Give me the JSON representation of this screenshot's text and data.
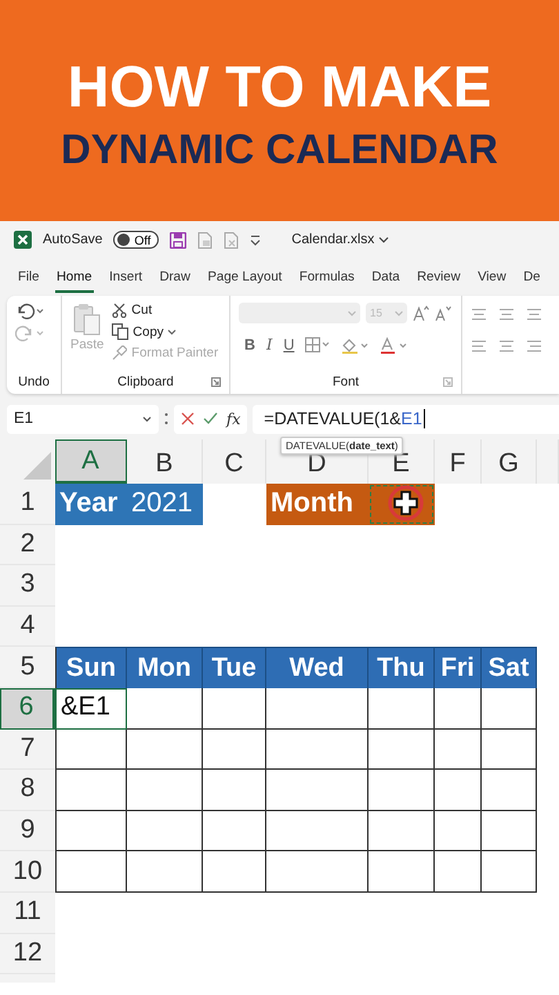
{
  "banner": {
    "line_1": "HOW TO MAKE",
    "line_2": "DYNAMIC CALENDAR"
  },
  "title_bar": {
    "autosave_label": "AutoSave",
    "autosave_toggle": {
      "text": "Off",
      "on": false
    },
    "file_name": "Calendar.xlsx"
  },
  "tabs": [
    {
      "label": "File",
      "selected": false
    },
    {
      "label": "Home",
      "selected": true
    },
    {
      "label": "Insert",
      "selected": false
    },
    {
      "label": "Draw",
      "selected": false
    },
    {
      "label": "Page Layout",
      "selected": false
    },
    {
      "label": "Formulas",
      "selected": false
    },
    {
      "label": "Data",
      "selected": false
    },
    {
      "label": "Review",
      "selected": false
    },
    {
      "label": "View",
      "selected": false
    },
    {
      "label": "De",
      "selected": false
    }
  ],
  "ribbon": {
    "undo": {
      "label": "Undo"
    },
    "clipboard": {
      "label": "Clipboard",
      "paste": "Paste",
      "cut": "Cut",
      "copy": "Copy",
      "format_painter": "Format Painter",
      "paste_disabled": true,
      "format_painter_disabled": true
    },
    "font": {
      "label": "Font",
      "size": "15",
      "bold": "B",
      "italic": "I",
      "underline": "U",
      "disabled": true
    }
  },
  "formula_bar": {
    "name_box": "E1",
    "function_label": "fx",
    "formula": "=DATEVALUE(1&",
    "formula_reference": "E1",
    "tooltip": "DATEVALUE(**date_text**)"
  },
  "sheet": {
    "columns": [
      "A",
      "B",
      "C",
      "D",
      "E",
      "F",
      "G"
    ],
    "rows": [
      {
        "number": "1",
        "kind": "plain",
        "cells": [
          {
            "text": "Year",
            "kind": "label",
            "color": "#2e75b6",
            "selected": false
          },
          {
            "text": "2021",
            "kind": "value",
            "color": "#2e75b6",
            "selected": false
          },
          {
            "kind": "blank",
            "selected": false
          },
          {
            "text": "Month",
            "kind": "label",
            "color": "#c55a11",
            "selected": false
          },
          {
            "kind": "referenced",
            "color": "#c55a11",
            "selected": false
          }
        ]
      },
      {
        "number": "2",
        "kind": "plain"
      },
      {
        "number": "3",
        "kind": "plain"
      },
      {
        "number": "4",
        "kind": "plain"
      },
      {
        "number": "5",
        "kind": "table-header",
        "cells": [
          {
            "text": "Sun",
            "selected": false
          },
          {
            "text": "Mon",
            "selected": false
          },
          {
            "text": "Tue",
            "selected": false
          },
          {
            "text": "Wed",
            "selected": false
          },
          {
            "text": "Thu",
            "selected": false
          },
          {
            "text": "Fri",
            "selected": false
          },
          {
            "text": "Sat",
            "selected": false
          }
        ]
      },
      {
        "number": "6",
        "kind": "table",
        "cells": [
          {
            "text": "&E1",
            "selected": true
          }
        ]
      },
      {
        "number": "7",
        "kind": "table"
      },
      {
        "number": "8",
        "kind": "table"
      },
      {
        "number": "9",
        "kind": "table"
      },
      {
        "number": "10",
        "kind": "table"
      },
      {
        "number": "11",
        "kind": "plain"
      },
      {
        "number": "12",
        "kind": "plain"
      }
    ]
  }
}
